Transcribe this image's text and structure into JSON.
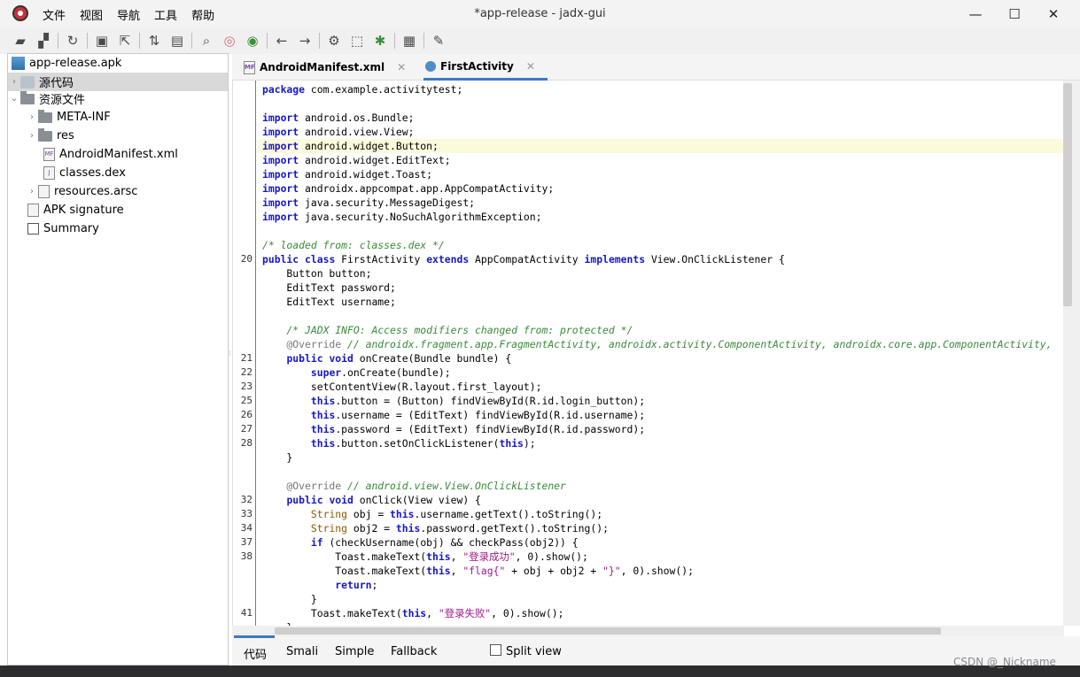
{
  "window": {
    "title": "*app-release - jadx-gui",
    "minimize": "—",
    "maximize": "☐",
    "close": "✕"
  },
  "menu": [
    "文件",
    "视图",
    "导航",
    "工具",
    "帮助"
  ],
  "tree": {
    "root": "app-release.apk",
    "source": "源代码",
    "resources": "资源文件",
    "meta_inf": "META-INF",
    "res": "res",
    "manifest": "AndroidManifest.xml",
    "dex": "classes.dex",
    "arsc": "resources.arsc",
    "apk_sig": "APK signature",
    "summary": "Summary"
  },
  "tabs": [
    {
      "label": "AndroidManifest.xml",
      "close": "✕"
    },
    {
      "label": "FirstActivity",
      "close": "✕"
    }
  ],
  "code_lines": [
    {
      "n": "",
      "t": "package com.example.activitytest;"
    },
    {
      "n": "",
      "t": ""
    },
    {
      "n": "",
      "t": "import android.os.Bundle;"
    },
    {
      "n": "",
      "t": "import android.view.View;"
    },
    {
      "n": "",
      "t": "import android.widget.Button;"
    },
    {
      "n": "",
      "t": "import android.widget.EditText;"
    },
    {
      "n": "",
      "t": "import android.widget.Toast;"
    },
    {
      "n": "",
      "t": "import androidx.appcompat.app.AppCompatActivity;"
    },
    {
      "n": "",
      "t": "import java.security.MessageDigest;"
    },
    {
      "n": "",
      "t": "import java.security.NoSuchAlgorithmException;"
    },
    {
      "n": "",
      "t": ""
    },
    {
      "n": "",
      "t": "/* loaded from: classes.dex */"
    },
    {
      "n": "20",
      "t": "public class FirstActivity extends AppCompatActivity implements View.OnClickListener {"
    },
    {
      "n": "",
      "t": "    Button button;"
    },
    {
      "n": "",
      "t": "    EditText password;"
    },
    {
      "n": "",
      "t": "    EditText username;"
    },
    {
      "n": "",
      "t": ""
    },
    {
      "n": "",
      "t": "    /* JADX INFO: Access modifiers changed from: protected */"
    },
    {
      "n": "",
      "t": "    @Override // androidx.fragment.app.FragmentActivity, androidx.activity.ComponentActivity, androidx.core.app.ComponentActivity,"
    },
    {
      "n": "21",
      "t": "    public void onCreate(Bundle bundle) {"
    },
    {
      "n": "22",
      "t": "        super.onCreate(bundle);"
    },
    {
      "n": "23",
      "t": "        setContentView(R.layout.first_layout);"
    },
    {
      "n": "25",
      "t": "        this.button = (Button) findViewById(R.id.login_button);"
    },
    {
      "n": "26",
      "t": "        this.username = (EditText) findViewById(R.id.username);"
    },
    {
      "n": "27",
      "t": "        this.password = (EditText) findViewById(R.id.password);"
    },
    {
      "n": "28",
      "t": "        this.button.setOnClickListener(this);"
    },
    {
      "n": "",
      "t": "    }"
    },
    {
      "n": "",
      "t": ""
    },
    {
      "n": "",
      "t": "    @Override // android.view.View.OnClickListener"
    },
    {
      "n": "32",
      "t": "    public void onClick(View view) {"
    },
    {
      "n": "33",
      "t": "        String obj = this.username.getText().toString();"
    },
    {
      "n": "34",
      "t": "        String obj2 = this.password.getText().toString();"
    },
    {
      "n": "37",
      "t": "        if (checkUsername(obj) && checkPass(obj2)) {"
    },
    {
      "n": "38",
      "t": "            Toast.makeText(this, \"登录成功\", 0).show();"
    },
    {
      "n": "",
      "t": "            Toast.makeText(this, \"flag{\" + obj + obj2 + \"}\", 0).show();"
    },
    {
      "n": "",
      "t": "            return;"
    },
    {
      "n": "",
      "t": "        }"
    },
    {
      "n": "41",
      "t": "        Toast.makeText(this, \"登录失败\", 0).show();"
    },
    {
      "n": "",
      "t": "    }"
    }
  ],
  "bottom_tabs": [
    "代码",
    "Smali",
    "Simple",
    "Fallback"
  ],
  "split_view": "Split view",
  "watermark": "CSDN @_Nickname"
}
